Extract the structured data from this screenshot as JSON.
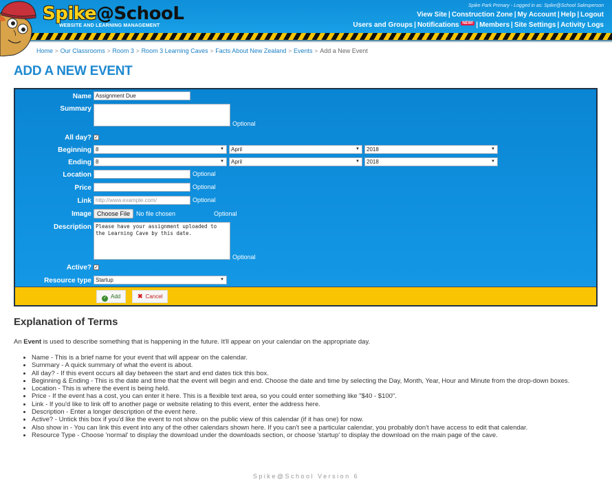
{
  "header": {
    "logo_main_spike": "Spike",
    "logo_main_school": "@SchooL",
    "logo_tagline": "Website and Learning Management",
    "logged_in_text": "Spike Park Primary - Logged in as: Spike@School Salesperson",
    "nav_row1": [
      "View Site",
      "Construction Zone",
      "My Account",
      "Help",
      "Logout"
    ],
    "nav_row2": [
      "Users and Groups",
      "Notifications",
      "Members",
      "Site Settings",
      "Activity Logs"
    ],
    "new_badge": "NEW!"
  },
  "breadcrumb": {
    "items": [
      "Home",
      "Our Classrooms",
      "Room 3",
      "Room 3 Learning Caves",
      "Facts About New Zealand",
      "Events"
    ],
    "current": "Add a New Event",
    "separator": ">"
  },
  "page_title": "ADD A NEW EVENT",
  "form": {
    "name": {
      "label": "Name",
      "value": "Assignment Due"
    },
    "summary": {
      "label": "Summary",
      "value": "",
      "hint": "Optional"
    },
    "all_day": {
      "label": "All day?",
      "checked": true
    },
    "beginning": {
      "label": "Beginning",
      "day": "8",
      "month": "April",
      "year": "2018"
    },
    "ending": {
      "label": "Ending",
      "day": "8",
      "month": "April",
      "year": "2018"
    },
    "location": {
      "label": "Location",
      "value": "",
      "hint": "Optional"
    },
    "price": {
      "label": "Price",
      "value": "",
      "hint": "Optional"
    },
    "link": {
      "label": "Link",
      "placeholder": "http://www.example.com/",
      "hint": "Optional"
    },
    "image": {
      "label": "Image",
      "button": "Choose File",
      "status": "No file chosen",
      "hint": "Optional"
    },
    "description": {
      "label": "Description",
      "value": "Please have your assignment uploaded to the Learning Cave by this date.",
      "hint": "Optional"
    },
    "active": {
      "label": "Active?",
      "checked": true
    },
    "resource_type": {
      "label": "Resource type",
      "value": "Startup"
    },
    "add_button": "Add",
    "cancel_button": "Cancel",
    "checkmark": "✓",
    "dropdown_arrow": "▼"
  },
  "explanation": {
    "title": "Explanation of Terms",
    "intro_prefix": "An ",
    "intro_bold": "Event",
    "intro_suffix": " is used to describe something that is happening in the future. It'll appear on your calendar on the appropriate day.",
    "items": [
      "Name - This is a brief name for your event that will appear on the calendar.",
      "Summary - A quick summary of what the event is about.",
      "All day? - If this event occurs all day between the start and end dates tick this box.",
      "Beginning & Ending - This is the date and time that the event will begin and end. Choose the date and time by selecting the Day, Month, Year, Hour and Minute from the drop-down boxes.",
      "Location - This is where the event is being held.",
      "Price - If the event has a cost, you can enter it here. This is a flexible text area, so you could enter something like \"$40 - $100\".",
      "Link - If you'd like to link off to another page or website relating to this event, enter the address here.",
      "Description - Enter a longer description of the event here.",
      "Active? - Untick this box if you'd like the event to not show on the public view of this calendar (if it has one) for now.",
      "Also show in - You can link this event into any of the other calendars shown here. If you can't see a particular calendar, you probably don't have access to edit that calendar.",
      "Resource Type - Choose 'normal' to display the download under the downloads section, or choose 'startup' to display the download on the main page of the cave."
    ]
  },
  "footer": "Spike@School Version 6",
  "colors": {
    "header_blue": "#0f8fd9",
    "form_blue": "#0a85d3",
    "action_bar_yellow": "#f9c402",
    "title_blue": "#1d88d0",
    "link_blue": "#1a7fc4"
  }
}
